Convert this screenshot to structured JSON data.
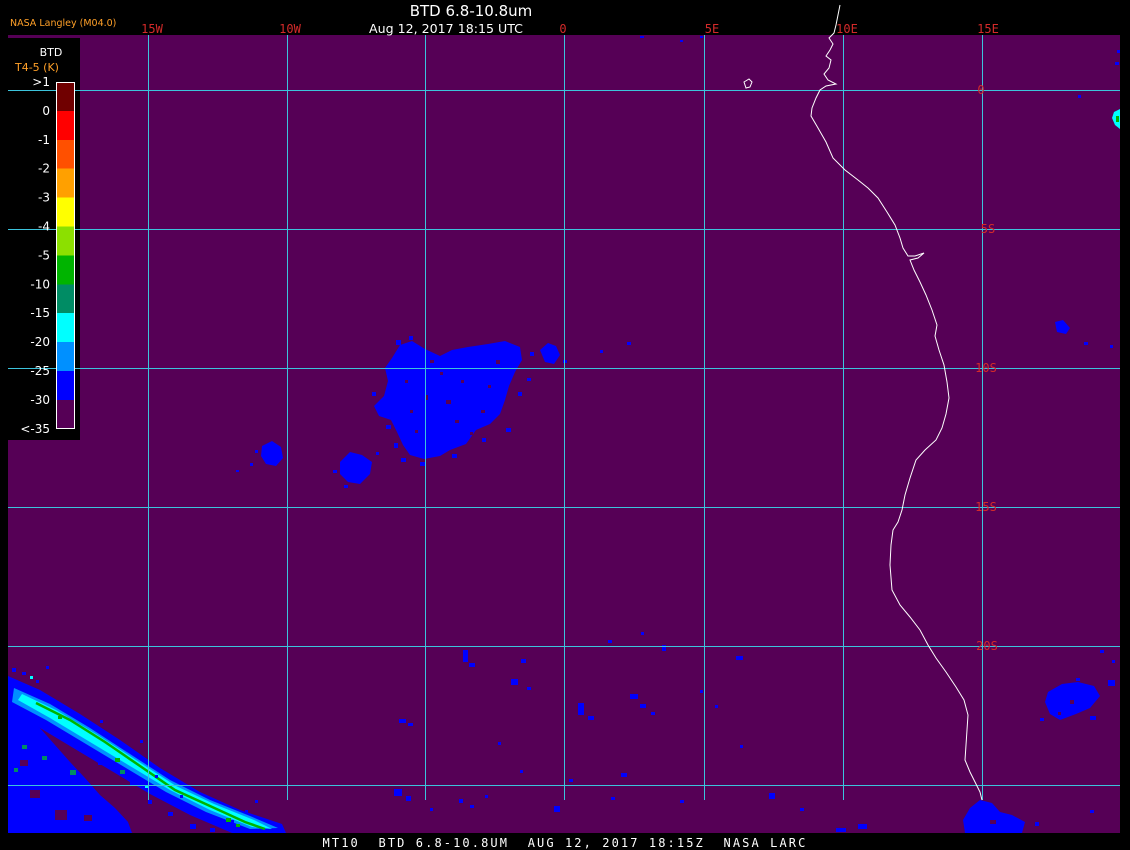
{
  "header": {
    "source": "NASA Langley (M04.0)",
    "title": "BTD 6.8-10.8um",
    "datetime": "Aug 12, 2017 18:15 UTC"
  },
  "map": {
    "longitude_labels": [
      "15W",
      "10W",
      "0",
      "5E",
      "10E",
      "15E"
    ],
    "latitude_labels": [
      "0",
      "5S",
      "10S",
      "15S",
      "20S"
    ]
  },
  "legend": {
    "title": "BTD",
    "units": "T4-5 (K)",
    "labels": [
      ">1",
      "0",
      "-1",
      "-2",
      "-3",
      "-4",
      "-5",
      "-10",
      "-15",
      "-20",
      "-25",
      "-30",
      "<-35"
    ],
    "colors": [
      "#700000",
      "#ff0000",
      "#ff5000",
      "#ffa000",
      "#ffff00",
      "#8ce000",
      "#00b400",
      "#008c64",
      "#00ffff",
      "#0090ff",
      "#0000ff",
      "#560056"
    ]
  },
  "footer": {
    "caption": "MT10  BTD 6.8-10.8UM  AUG 12, 2017 18:15Z  NASA LARC"
  },
  "colors": {
    "page_background": "#000000",
    "map_background": "#560056",
    "grid": "#3cc4dc",
    "grid_label": "#d42a2a",
    "coastline": "#ffffff",
    "text": "#ffffff",
    "annotation": "#ffa028"
  }
}
